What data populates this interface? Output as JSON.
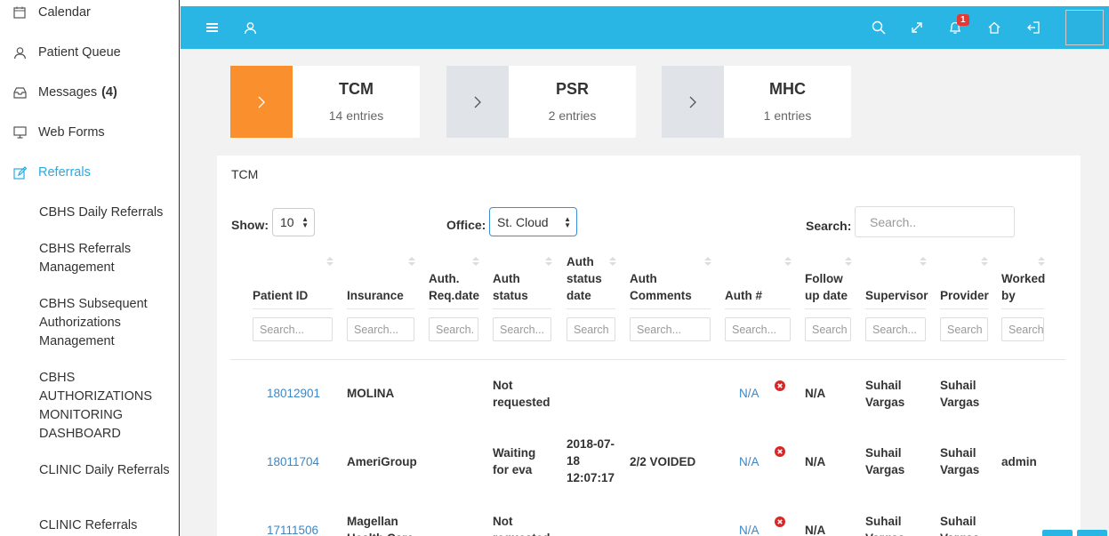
{
  "sidebar": {
    "items": [
      {
        "label": "Calendar",
        "icon": "calendar-icon"
      },
      {
        "label": "Patient Queue",
        "icon": "user-icon"
      },
      {
        "label": "Messages",
        "count": "(4)",
        "icon": "inbox-icon"
      },
      {
        "label": "Web Forms",
        "icon": "monitor-icon"
      },
      {
        "label": "Referrals",
        "icon": "edit-icon",
        "active": true
      }
    ],
    "subitems": [
      "CBHS Daily Referrals",
      "CBHS Referrals Management",
      "CBHS Subsequent Authorizations Management",
      "CBHS AUTHORIZATIONS MONITORING DASHBOARD",
      "CLINIC Daily Referrals",
      "CLINIC Referrals"
    ],
    "active_color": "#29abe2"
  },
  "topbar": {
    "color": "#29b6e5",
    "notification_count": "1",
    "icons": [
      "menu-icon",
      "user-icon",
      "search-icon",
      "expand-icon",
      "bell-icon",
      "home-icon",
      "logout-icon"
    ]
  },
  "cards": [
    {
      "title": "TCM",
      "subtitle": "14 entries",
      "active": true
    },
    {
      "title": "PSR",
      "subtitle": "2 entries",
      "active": false
    },
    {
      "title": "MHC",
      "subtitle": "1 entries",
      "active": false
    }
  ],
  "accent_color": "#fa8f2e",
  "panel": {
    "title": "TCM",
    "show_label": "Show:",
    "show_value": "10",
    "office_label": "Office:",
    "office_value": "St. Cloud",
    "search_label": "Search:",
    "search_placeholder": "Search.."
  },
  "table": {
    "columns": [
      {
        "label": "Patient ID",
        "placeholder": "Search..."
      },
      {
        "label": "Insurance",
        "placeholder": "Search..."
      },
      {
        "label": "Auth. Req.date",
        "placeholder": "Search."
      },
      {
        "label": "Auth status",
        "placeholder": "Search..."
      },
      {
        "label": "Auth status date",
        "placeholder": "Search"
      },
      {
        "label": "Auth Comments",
        "placeholder": "Search..."
      },
      {
        "label": "Auth #",
        "placeholder": "Search..."
      },
      {
        "label": "Follow up date",
        "placeholder": "Search"
      },
      {
        "label": "Supervisor",
        "placeholder": "Search..."
      },
      {
        "label": "Provider",
        "placeholder": "Search"
      },
      {
        "label": "Worked by",
        "placeholder": "Search"
      }
    ],
    "rows": [
      {
        "patient_id": "18012901",
        "insurance": "MOLINA",
        "req_date": "",
        "status": "Not requested",
        "status_date": "",
        "comments": "",
        "auth_no": "N/A",
        "follow_up": "N/A",
        "supervisor": "Suhail Vargas",
        "provider": "Suhail Vargas",
        "worked_by": ""
      },
      {
        "patient_id": "18011704",
        "insurance": "AmeriGroup",
        "req_date": "",
        "status": "Waiting for eva",
        "status_date": "2018-07-18 12:07:17",
        "comments": "2/2 VOIDED",
        "auth_no": "N/A",
        "follow_up": "N/A",
        "supervisor": "Suhail Vargas",
        "provider": "Suhail Vargas",
        "worked_by": "admin"
      },
      {
        "patient_id": "17111506",
        "insurance": "Magellan Health Care",
        "req_date": "",
        "status": "Not requested",
        "status_date": "",
        "comments": "",
        "auth_no": "N/A",
        "follow_up": "N/A",
        "supervisor": "Suhail Vargas",
        "provider": "Suhail Vargas",
        "worked_by": ""
      }
    ]
  }
}
